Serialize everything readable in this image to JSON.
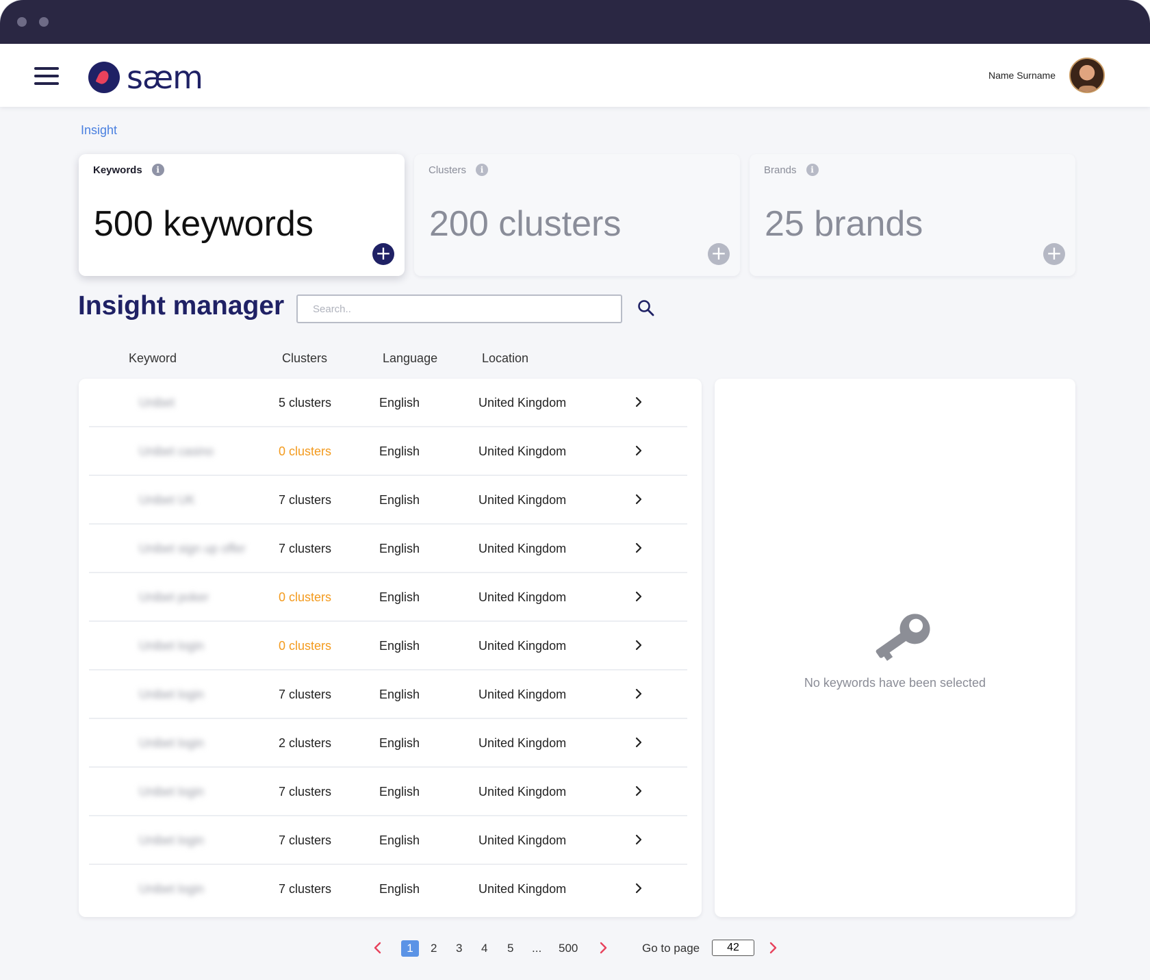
{
  "header": {
    "logo_text": "sæm",
    "user_name": "Name Surname"
  },
  "breadcrumb": "Insight",
  "stats": [
    {
      "label": "Keywords",
      "value": "500 keywords",
      "active": true
    },
    {
      "label": "Clusters",
      "value": "200 clusters",
      "active": false
    },
    {
      "label": "Brands",
      "value": "25 brands",
      "active": false
    }
  ],
  "manager": {
    "title": "Insight manager",
    "search_placeholder": "Search.."
  },
  "columns": [
    "Keyword",
    "Clusters",
    "Language",
    "Location"
  ],
  "rows": [
    {
      "keyword": "Unibet",
      "clusters": "5 clusters",
      "language": "English",
      "location": "United Kingdom",
      "zero": false
    },
    {
      "keyword": "Unibet casino",
      "clusters": "0 clusters",
      "language": "English",
      "location": "United Kingdom",
      "zero": true
    },
    {
      "keyword": "Unibet UK",
      "clusters": "7 clusters",
      "language": "English",
      "location": "United Kingdom",
      "zero": false
    },
    {
      "keyword": "Unibet sign up offer",
      "clusters": "7 clusters",
      "language": "English",
      "location": "United Kingdom",
      "zero": false
    },
    {
      "keyword": "Unibet poker",
      "clusters": "0 clusters",
      "language": "English",
      "location": "United Kingdom",
      "zero": true
    },
    {
      "keyword": "Unibet login",
      "clusters": "0 clusters",
      "language": "English",
      "location": "United Kingdom",
      "zero": true
    },
    {
      "keyword": "Unibet login",
      "clusters": "7 clusters",
      "language": "English",
      "location": "United Kingdom",
      "zero": false
    },
    {
      "keyword": "Unibet login",
      "clusters": "2 clusters",
      "language": "English",
      "location": "United Kingdom",
      "zero": false
    },
    {
      "keyword": "Unibet login",
      "clusters": "7 clusters",
      "language": "English",
      "location": "United Kingdom",
      "zero": false
    },
    {
      "keyword": "Unibet login",
      "clusters": "7 clusters",
      "language": "English",
      "location": "United Kingdom",
      "zero": false
    },
    {
      "keyword": "Unibet login",
      "clusters": "7 clusters",
      "language": "English",
      "location": "United Kingdom",
      "zero": false
    }
  ],
  "detail": {
    "empty_text": "No keywords have been selected",
    "icon": "key-icon"
  },
  "pagination": {
    "pages": [
      "1",
      "2",
      "3",
      "4",
      "5",
      "...",
      "500"
    ],
    "current": "1",
    "goto_label": "Go to page",
    "goto_value": "42"
  },
  "colors": {
    "brand": "#1f2165",
    "accent": "#e8425c",
    "link": "#4a80e0",
    "warning": "#f39a1d",
    "pager_active": "#5b93e6",
    "pager_arrow": "#e8425c"
  }
}
